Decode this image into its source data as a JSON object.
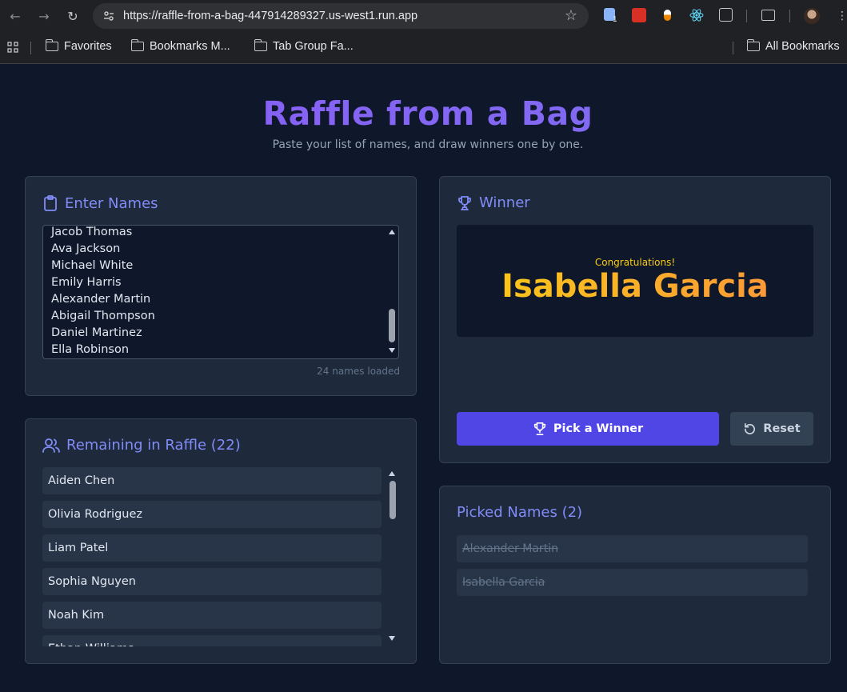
{
  "browser": {
    "url": "https://raffle-from-a-bag-447914289327.us-west1.run.app",
    "extension_badge": "1",
    "bookmarks": [
      "Favorites",
      "Bookmarks M...",
      "Tab Group Fa...",
      "All Bookmarks"
    ]
  },
  "header": {
    "title": "Raffle from a Bag",
    "subtitle": "Paste your list of names, and draw winners one by one."
  },
  "enter_names": {
    "heading": "Enter Names",
    "visible_lines": [
      "Jacob Thomas",
      "Ava Jackson",
      "Michael White",
      "Emily Harris",
      "Alexander Martin",
      "Abigail Thompson",
      "Daniel Martinez",
      "Ella Robinson"
    ],
    "count_label": "24 names loaded"
  },
  "remaining": {
    "heading": "Remaining in Raffle (22)",
    "items": [
      "Aiden Chen",
      "Olivia Rodriguez",
      "Liam Patel",
      "Sophia Nguyen",
      "Noah Kim",
      "Ethan Williams"
    ]
  },
  "winner": {
    "heading": "Winner",
    "congrats": "Congratulations!",
    "name": "Isabella Garcia",
    "pick_label": "Pick a Winner",
    "reset_label": "Reset"
  },
  "picked": {
    "heading": "Picked Names (2)",
    "items": [
      "Alexander Martin",
      "Isabella Garcia"
    ]
  },
  "colors": {
    "accent": "#818cf8",
    "primary_button": "#4f46e5",
    "winner_gradient_start": "#facc15",
    "winner_gradient_end": "#fb923c"
  }
}
